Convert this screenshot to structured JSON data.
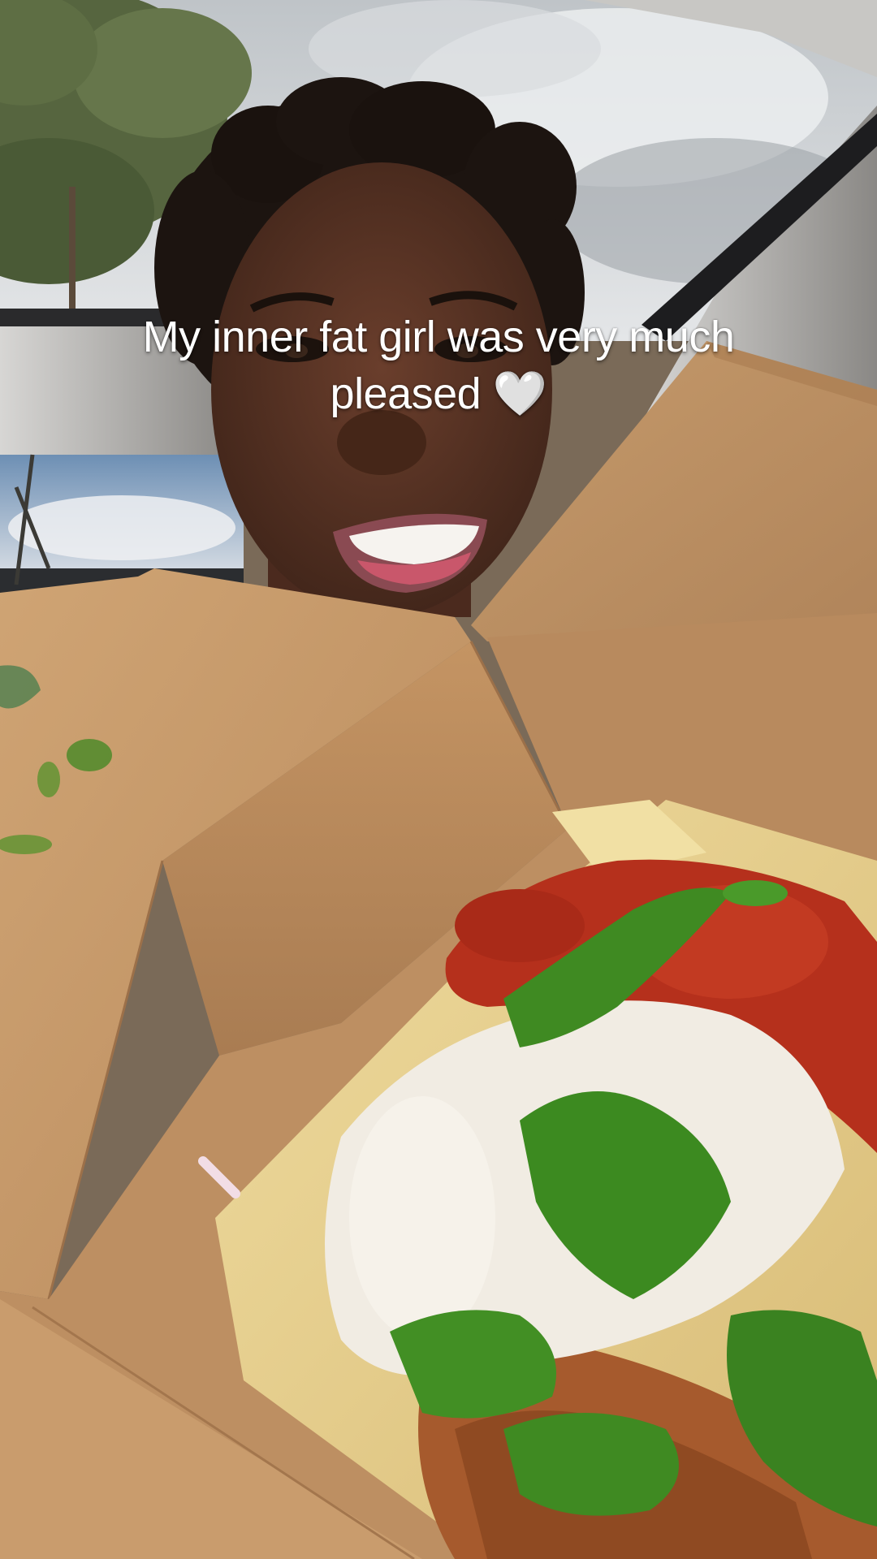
{
  "caption": {
    "text": "My inner fat girl was very much pleased",
    "emoji": "🤍"
  },
  "scene": {
    "subject": "woman smiling in car holding kraft takeout box with breaded chicken sandwich topped with red sauce, green herb sauce and white cream",
    "colors": {
      "sky": "#c9cdd1",
      "cloud": "#e9ebed",
      "tree": "#4f5e3e",
      "box_kraft": "#c79a6b",
      "box_kraft_dark": "#b4865a",
      "skin": "#5a3526",
      "bread": "#e7cf8f",
      "red_sauce": "#b5301c",
      "green_sauce": "#3f8a22",
      "white_sauce": "#f1ece3",
      "breading": "#a25a2e"
    }
  }
}
